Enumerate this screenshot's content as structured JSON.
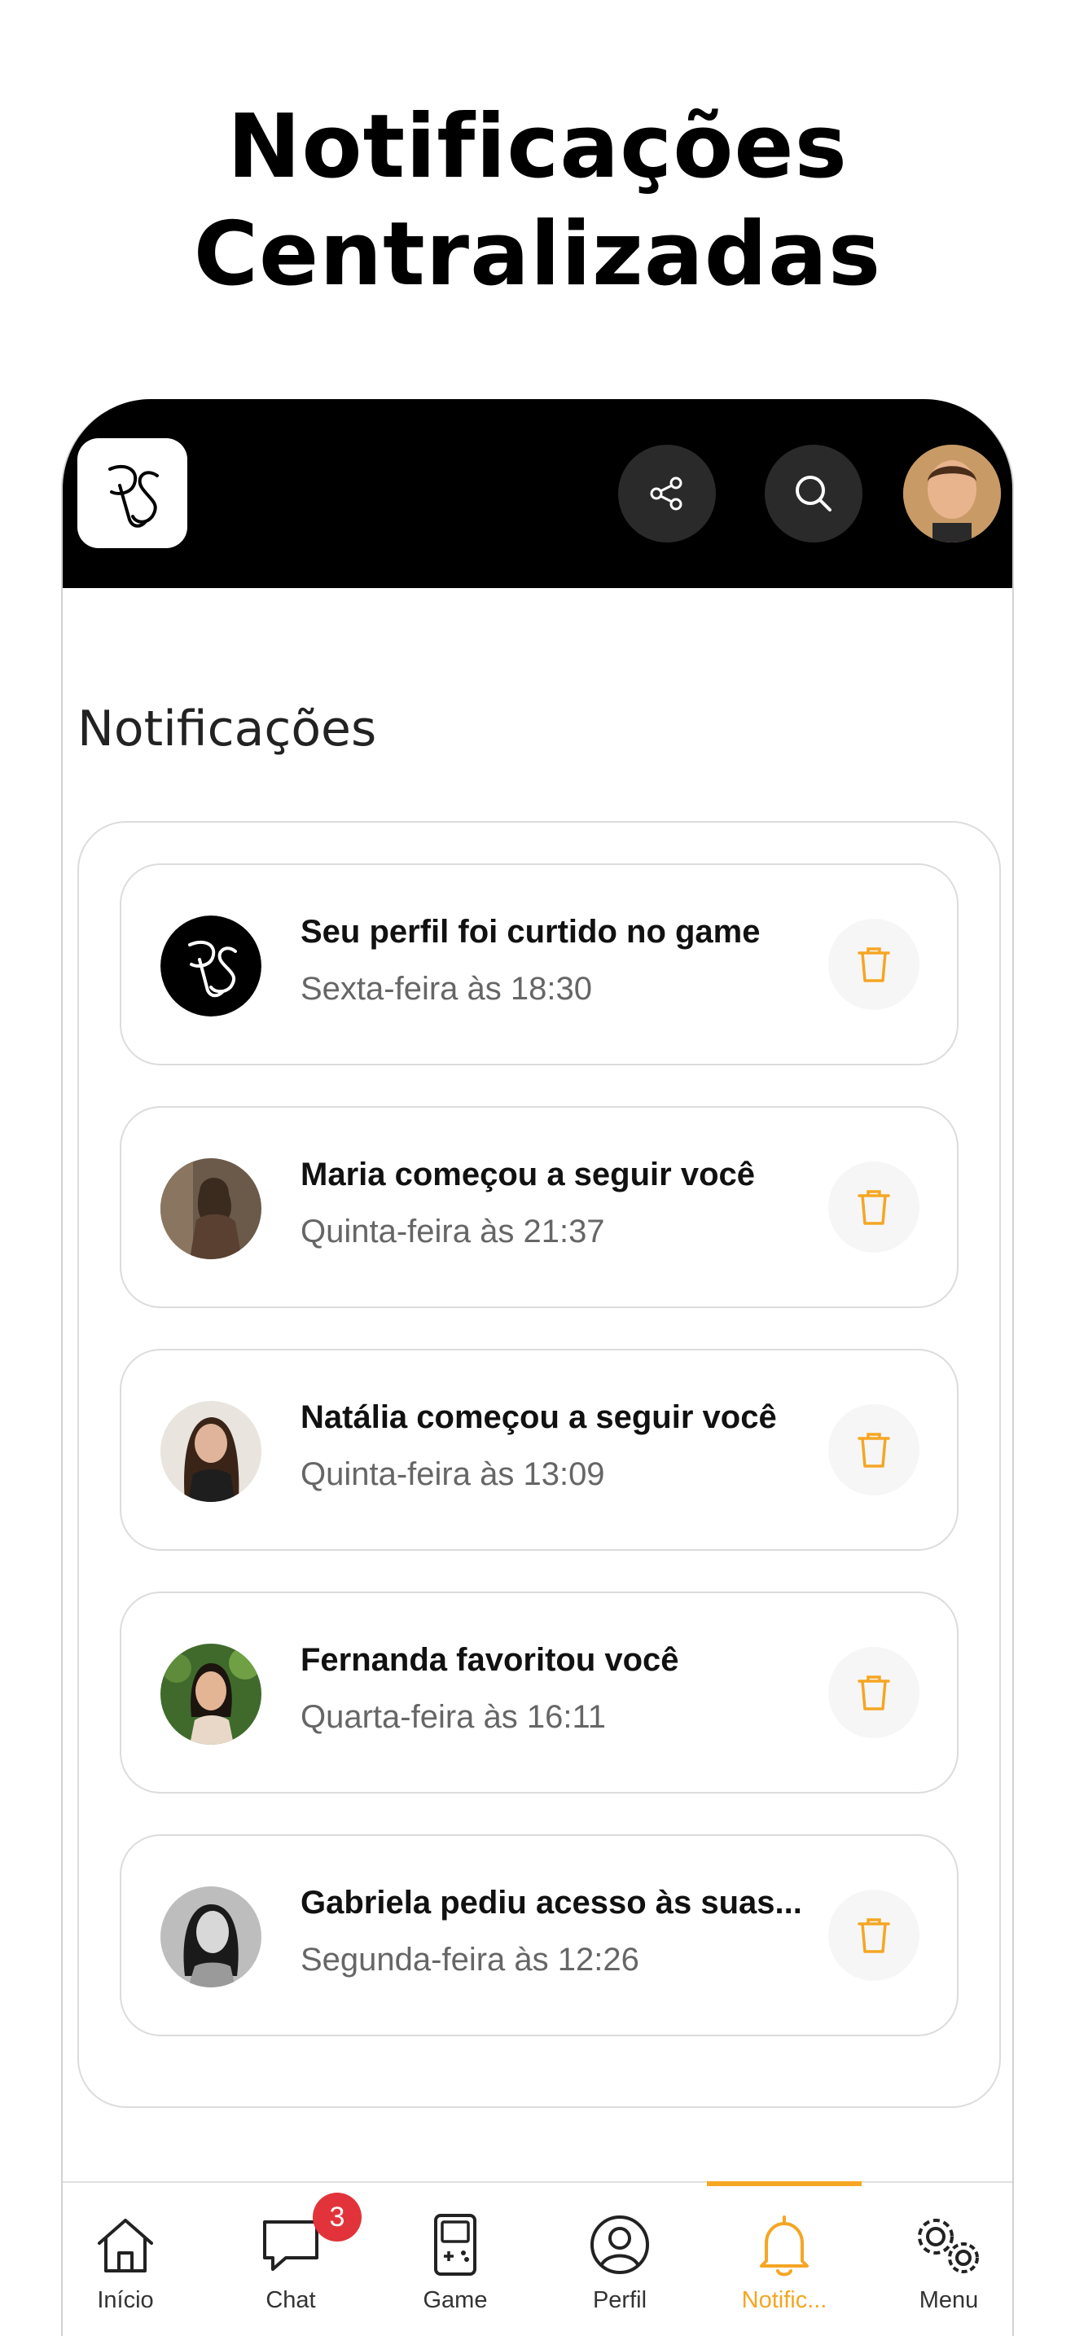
{
  "headline": {
    "line1": "Notificações",
    "line2": "Centralizadas"
  },
  "appbar": {
    "logo_text": "RS",
    "share_icon": "share-icon",
    "search_icon": "search-icon",
    "avatar": "user-avatar"
  },
  "page": {
    "title": "Notificações"
  },
  "notifications": [
    {
      "title": "Seu perfil foi curtido no game",
      "time": "Sexta-feira às 18:30",
      "avatar": "rs-logo"
    },
    {
      "title": "Maria começou a seguir você",
      "time": "Quinta-feira às 21:37",
      "avatar": "maria"
    },
    {
      "title": "Natália começou a seguir você",
      "time": "Quinta-feira às 13:09",
      "avatar": "natalia"
    },
    {
      "title": "Fernanda favoritou você",
      "time": "Quarta-feira às 16:11",
      "avatar": "fernanda"
    },
    {
      "title": "Gabriela pediu acesso às suas...",
      "time": "Segunda-feira às 12:26",
      "avatar": "gabriela"
    }
  ],
  "nav": {
    "items": [
      {
        "label": "Início",
        "icon": "home-icon"
      },
      {
        "label": "Chat",
        "icon": "chat-icon",
        "badge": "3"
      },
      {
        "label": "Game",
        "icon": "gameboy-icon"
      },
      {
        "label": "Perfil",
        "icon": "profile-icon"
      },
      {
        "label": "Notific...",
        "icon": "bell-icon",
        "active": true
      },
      {
        "label": "Menu",
        "icon": "gears-icon"
      }
    ]
  },
  "colors": {
    "accent": "#f5a623",
    "badge": "#e2333b",
    "appbar": "#000000"
  }
}
